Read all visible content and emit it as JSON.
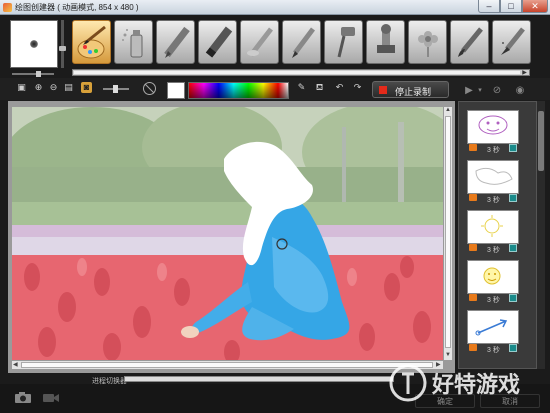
{
  "window": {
    "title": "绘图创建器 ( 动画模式, 854 x 480 )",
    "minimize_glyph": "–",
    "maximize_glyph": "□",
    "close_glyph": "✕"
  },
  "brush": {
    "preview_icon": "brush-dot",
    "opacity_marks": "- +"
  },
  "tools": [
    {
      "name": "paint-brush-palette-icon",
      "active": true
    },
    {
      "name": "spray-can-icon",
      "active": false
    },
    {
      "name": "crayon-icon",
      "active": false
    },
    {
      "name": "marker-icon",
      "active": false
    },
    {
      "name": "airbrush-icon",
      "active": false
    },
    {
      "name": "pencil-icon",
      "active": false
    },
    {
      "name": "paint-roller-icon",
      "active": false
    },
    {
      "name": "stamp-icon",
      "active": false
    },
    {
      "name": "flower-stamp-icon",
      "active": false
    },
    {
      "name": "watercolor-brush-icon",
      "active": false
    },
    {
      "name": "glitter-brush-icon",
      "active": false
    }
  ],
  "toolbar": {
    "icons": [
      "layer-icon",
      "zoom-in-icon",
      "zoom-out-icon",
      "fit-icon",
      "image-icon"
    ],
    "stop_record_label": "停止录制",
    "current_color": "#ffffff"
  },
  "frames": [
    {
      "time": "3 秒",
      "motif": "face"
    },
    {
      "time": "3 秒",
      "motif": "map"
    },
    {
      "time": "3 秒",
      "motif": "sun-yellow"
    },
    {
      "time": "3 秒",
      "motif": "sun-face"
    },
    {
      "time": "3 秒",
      "motif": "arrow"
    }
  ],
  "status": {
    "label": "进程切换器",
    "progress": 0
  },
  "bottom": {
    "buttons": [
      "确定",
      "取消"
    ]
  },
  "watermark": {
    "text": "好特游戏"
  }
}
